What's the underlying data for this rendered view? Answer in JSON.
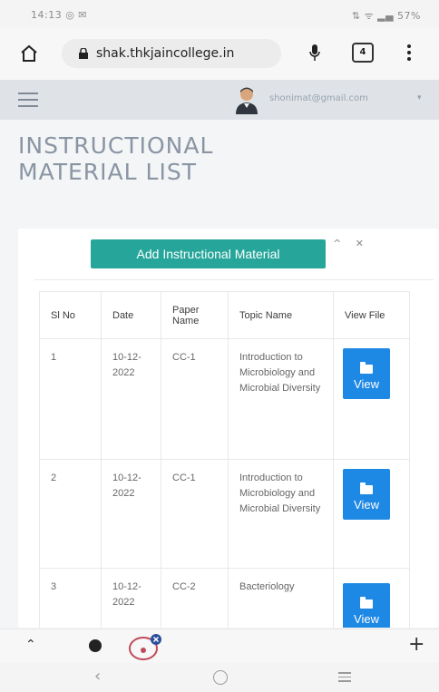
{
  "status_bar": {
    "time": "14:13",
    "left_icons": "◎ ✉",
    "right_icons": "⇅ ᯤ ▂▄ 57%"
  },
  "browser": {
    "url": "shak.thkjaincollege.in",
    "tab_count": "4"
  },
  "header": {
    "user_email": "shonimat@gmail.com",
    "caret": "▾"
  },
  "page": {
    "title": "INSTRUCTIONAL MATERIAL LIST"
  },
  "card": {
    "add_button_label": "Add Instructional Material",
    "tools": "^ ✕",
    "columns": [
      "Sl No",
      "Date",
      "Paper Name",
      "Topic Name",
      "View File"
    ],
    "rows": [
      {
        "sl": "1",
        "date": "10-12-2022",
        "paper": "CC-1",
        "topic": "Introduction to Microbiology and Microbial Diversity",
        "view": "View"
      },
      {
        "sl": "2",
        "date": "10-12-2022",
        "paper": "CC-1",
        "topic": "Introduction to Microbiology and Microbial Diversity",
        "view": "View"
      },
      {
        "sl": "3",
        "date": "10-12-2022",
        "paper": "CC-2",
        "topic": "Bacteriology",
        "view": "View"
      }
    ]
  },
  "colors": {
    "teal": "#26a69a",
    "blue": "#1e88e5",
    "header_bg": "#dfe3e8",
    "title": "#8a95a3"
  }
}
